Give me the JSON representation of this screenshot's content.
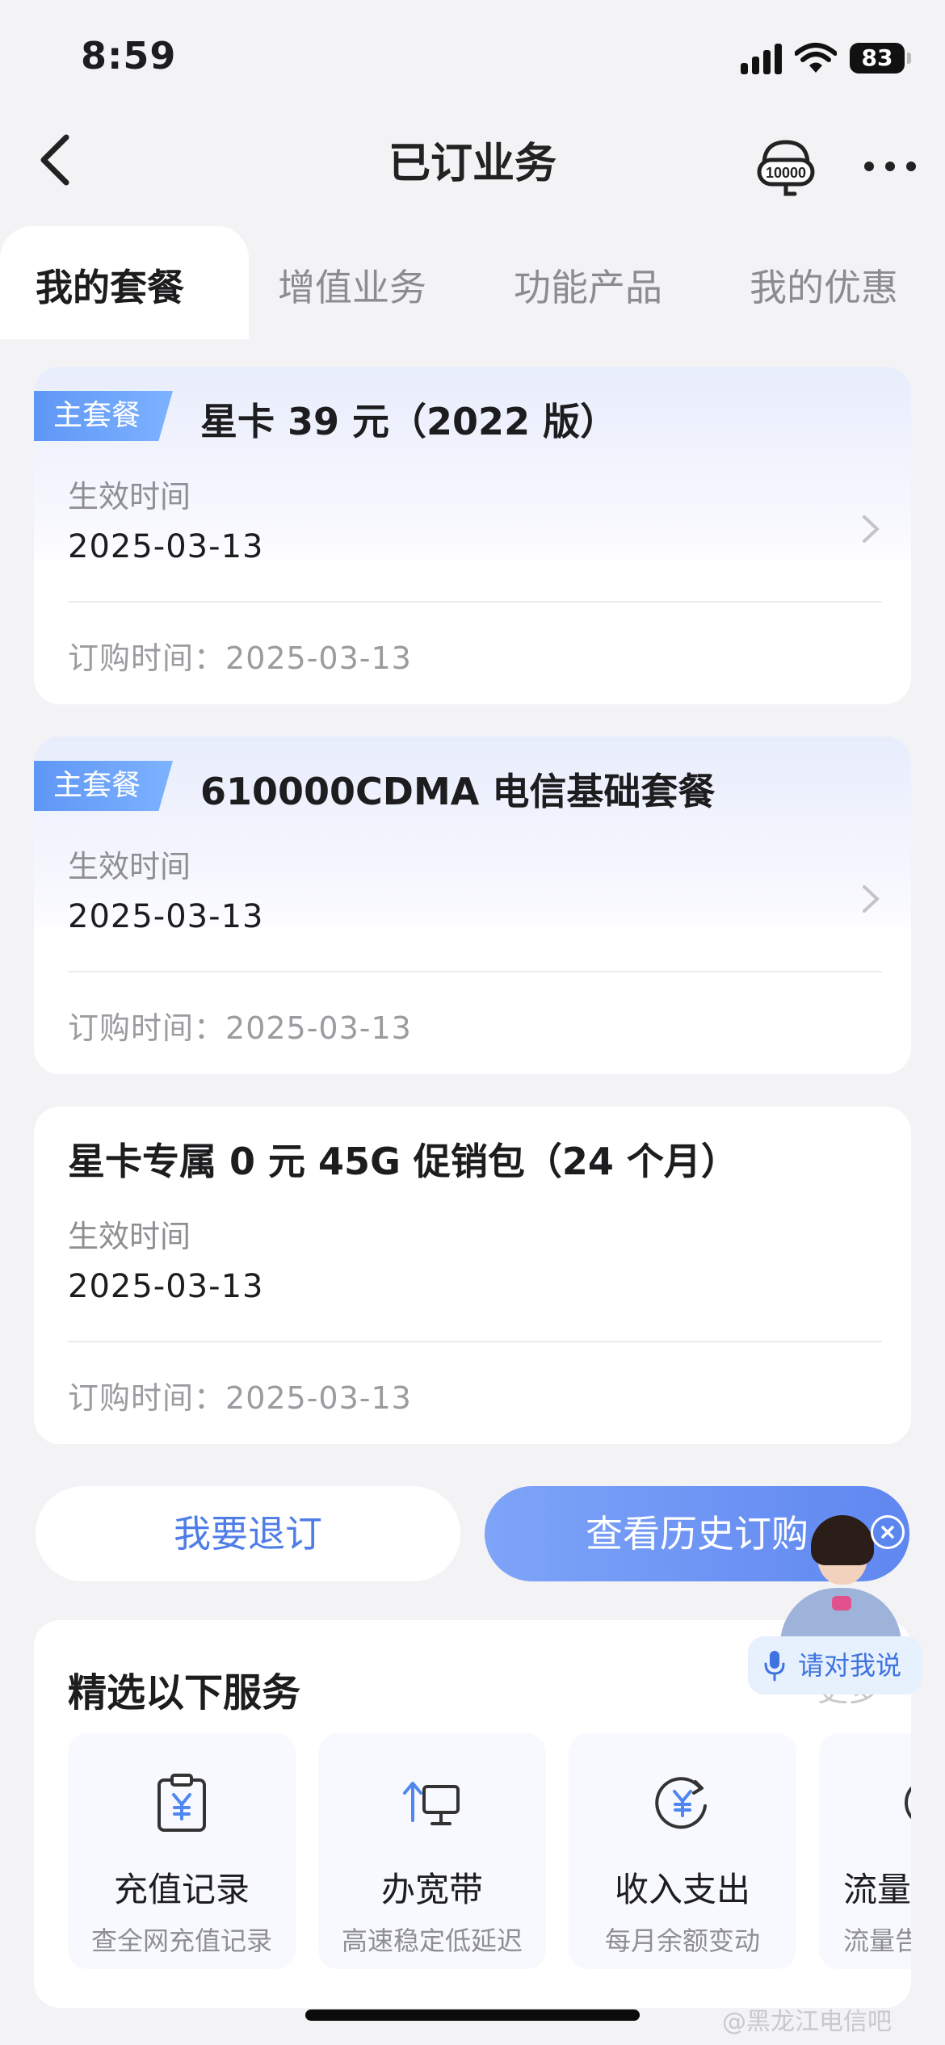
{
  "status_bar": {
    "time": "8:59",
    "battery": "83"
  },
  "header": {
    "title": "已订业务"
  },
  "tabs": [
    {
      "label": "我的套餐",
      "active": true
    },
    {
      "label": "增值业务",
      "active": false
    },
    {
      "label": "功能产品",
      "active": false
    },
    {
      "label": "我的优惠",
      "active": false
    }
  ],
  "packages": [
    {
      "badge": "主套餐",
      "title": "星卡 39 元（2022 版）",
      "effective_label": "生效时间",
      "effective_date": "2025-03-13",
      "order_label": "订购时间：",
      "order_date": "2025-03-13"
    },
    {
      "badge": "主套餐",
      "title": "610000CDMA 电信基础套餐",
      "effective_label": "生效时间",
      "effective_date": "2025-03-13",
      "order_label": "订购时间：",
      "order_date": "2025-03-13"
    },
    {
      "badge": "",
      "title": "星卡专属 0 元 45G 促销包（24 个月）",
      "effective_label": "生效时间",
      "effective_date": "2025-03-13",
      "order_label": "订购时间：",
      "order_date": "2025-03-13"
    }
  ],
  "actions": {
    "unsubscribe": "我要退订",
    "history": "查看历史订购"
  },
  "services": {
    "title": "精选以下服务",
    "more": "更多",
    "items": [
      {
        "name": "充值记录",
        "desc": "查全网充值记录",
        "icon": "clipboard-yuan-icon"
      },
      {
        "name": "办宽带",
        "desc": "高速稳定低延迟",
        "icon": "broadband-icon"
      },
      {
        "name": "收入支出",
        "desc": "每月余额变动",
        "icon": "yuan-cycle-icon"
      },
      {
        "name": "流量",
        "desc": "流量告",
        "icon": "traffic-icon"
      }
    ]
  },
  "assistant": {
    "prompt": "请对我说"
  },
  "watermark": "@黑龙江电信吧",
  "colors": {
    "accent": "#5f87f0",
    "badge": "#5e96f5",
    "background": "#f3f3f5"
  }
}
